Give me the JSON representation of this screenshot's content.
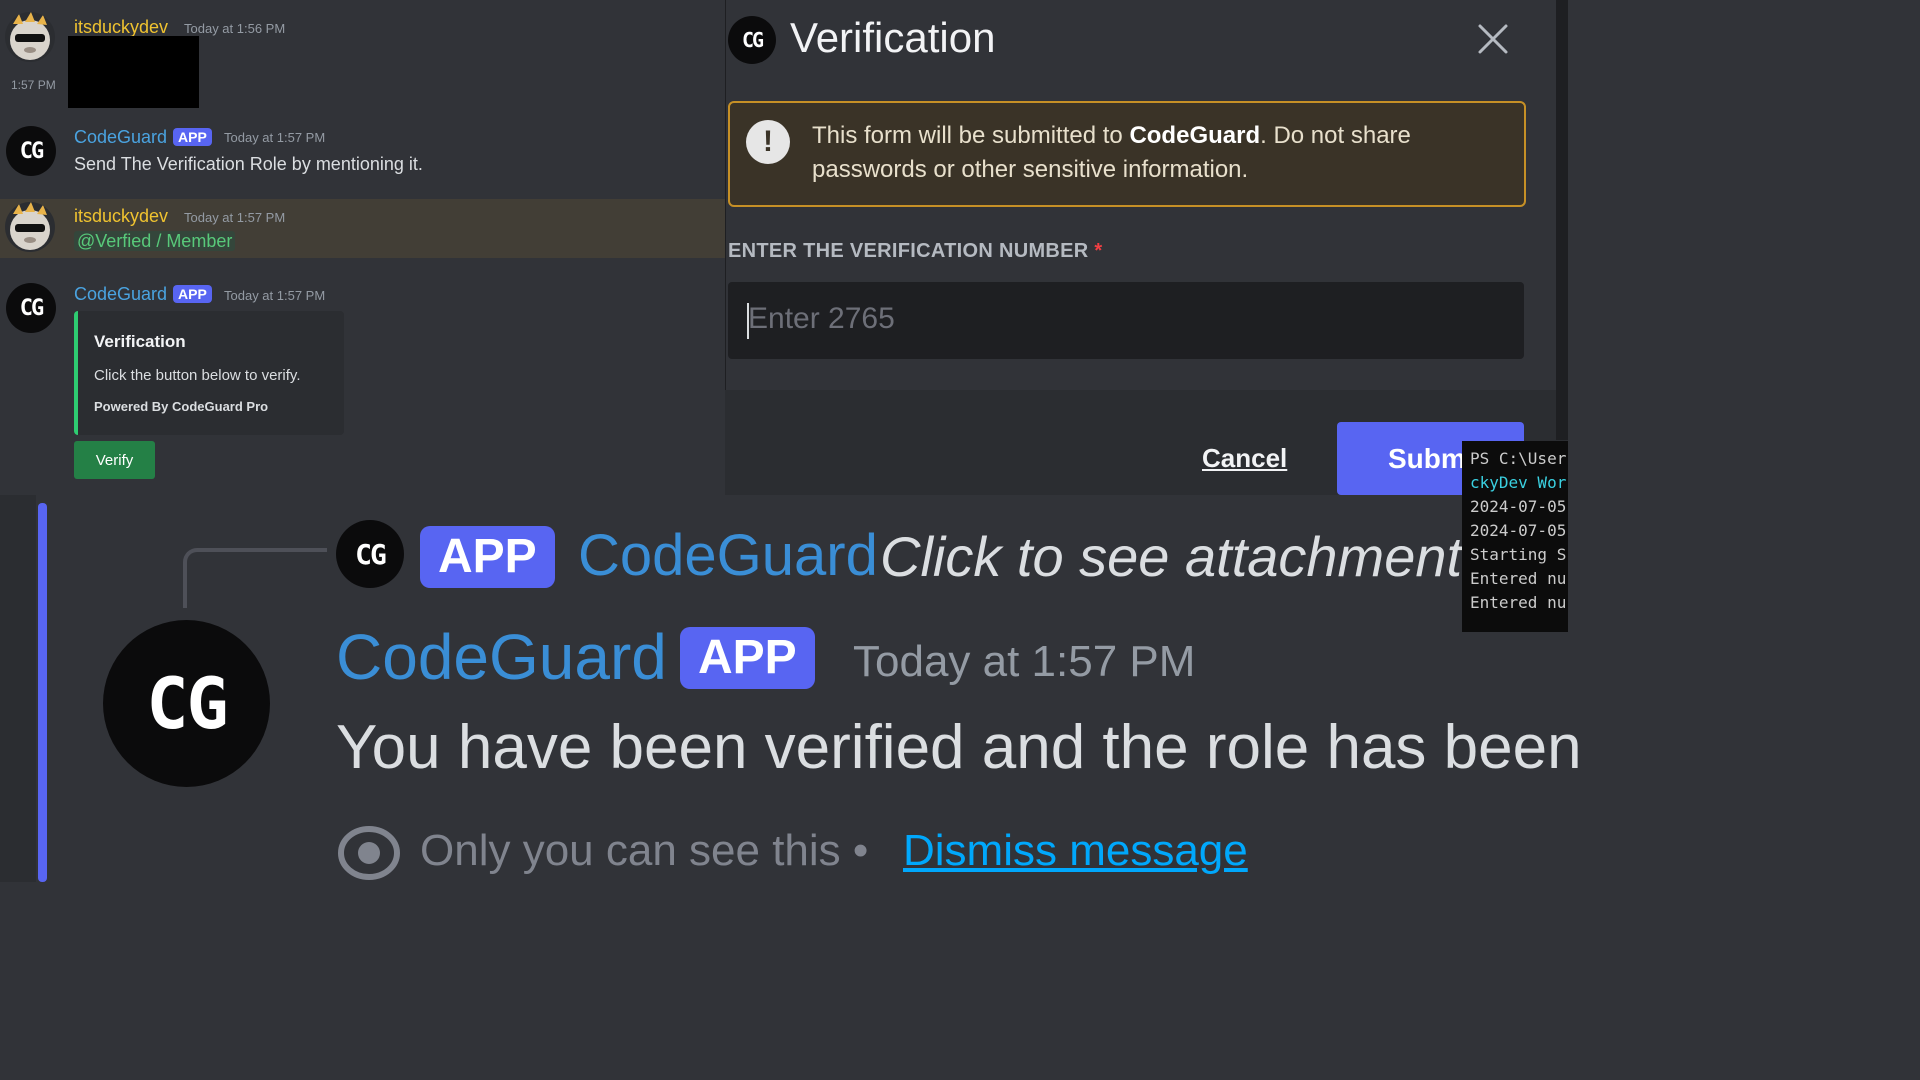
{
  "chat": {
    "messages": [
      {
        "author": "itsduckydev",
        "timestamp": "Today at 1:56 PM",
        "side_time": "1:57 PM"
      },
      {
        "author": "CodeGuard",
        "badge": "APP",
        "timestamp": "Today at 1:57 PM",
        "text": "Send The Verification Role by mentioning it."
      },
      {
        "author": "itsduckydev",
        "timestamp": "Today at 1:57 PM",
        "mention": "@Verfied / Member"
      },
      {
        "author": "CodeGuard",
        "badge": "APP",
        "timestamp": "Today at 1:57 PM",
        "embed": {
          "title": "Verification",
          "description": "Click the button below to verify.",
          "footer": "Powered By CodeGuard Pro"
        },
        "button": "Verify"
      }
    ],
    "avatar_initials": "CG"
  },
  "modal": {
    "title": "Verification",
    "warning_pre": "This form will be submitted to ",
    "warning_bold": "CodeGuard",
    "warning_post": ". Do not share passwords or other sensitive information.",
    "field_label": "ENTER THE VERIFICATION NUMBER",
    "required_mark": "*",
    "placeholder": "Enter 2765",
    "cancel": "Cancel",
    "submit": "Submi"
  },
  "terminal": {
    "lines": [
      "PS C:\\User",
      "ckyDev Wor",
      "2024-07-05",
      "2024-07-05",
      "Starting S",
      "Entered nu",
      "Entered nu"
    ]
  },
  "zoom": {
    "reply_badge": "APP",
    "reply_author": "CodeGuard",
    "reply_text": "Click to see attachment",
    "author": "CodeGuard",
    "badge": "APP",
    "timestamp": "Today at 1:57 PM",
    "text": "You have been verified and the role has been",
    "ephemeral": "Only you can see this •",
    "dismiss": "Dismiss message"
  },
  "colors": {
    "blurple": "#5865f2",
    "username_duck": "#f0c330",
    "username_bot": "#4aa3e0",
    "green_button": "#248046",
    "warn_border": "#c69026"
  }
}
